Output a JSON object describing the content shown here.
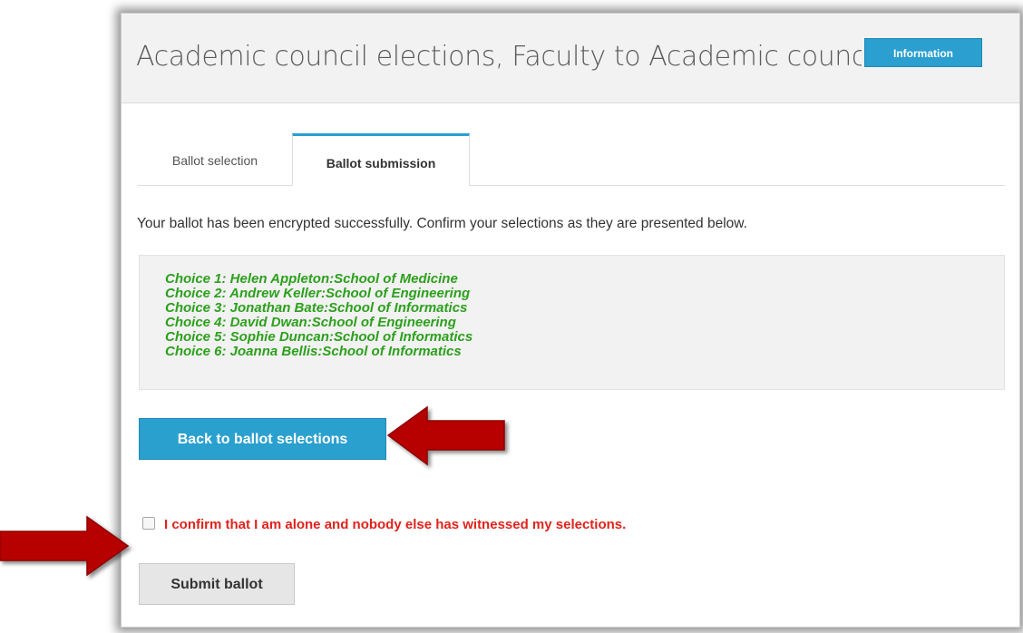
{
  "header": {
    "title": "Academic council elections, Faculty to Academic council el",
    "info_button": "Information"
  },
  "tabs": [
    {
      "label": "Ballot selection",
      "active": false
    },
    {
      "label": "Ballot submission",
      "active": true
    }
  ],
  "intro_text": "Your ballot has been encrypted successfully. Confirm your selections as they are presented below.",
  "choices": [
    "Choice 1: Helen Appleton:School of Medicine",
    "Choice 2: Andrew Keller:School of Engineering",
    "Choice 3: Jonathan Bate:School of Informatics",
    "Choice 4: David Dwan:School of Engineering",
    "Choice 5: Sophie Duncan:School of Informatics",
    "Choice 6: Joanna Bellis:School of Informatics"
  ],
  "back_button": "Back to ballot selections",
  "confirm_checkbox": {
    "label": "I confirm that I am alone and nobody else has witnessed my selections.",
    "checked": false
  },
  "submit_button": "Submit ballot",
  "colors": {
    "accent": "#2aa0cf",
    "choice_text": "#2ca01c",
    "warning_text": "#e0231c",
    "annotation_arrow": "#c00000"
  }
}
